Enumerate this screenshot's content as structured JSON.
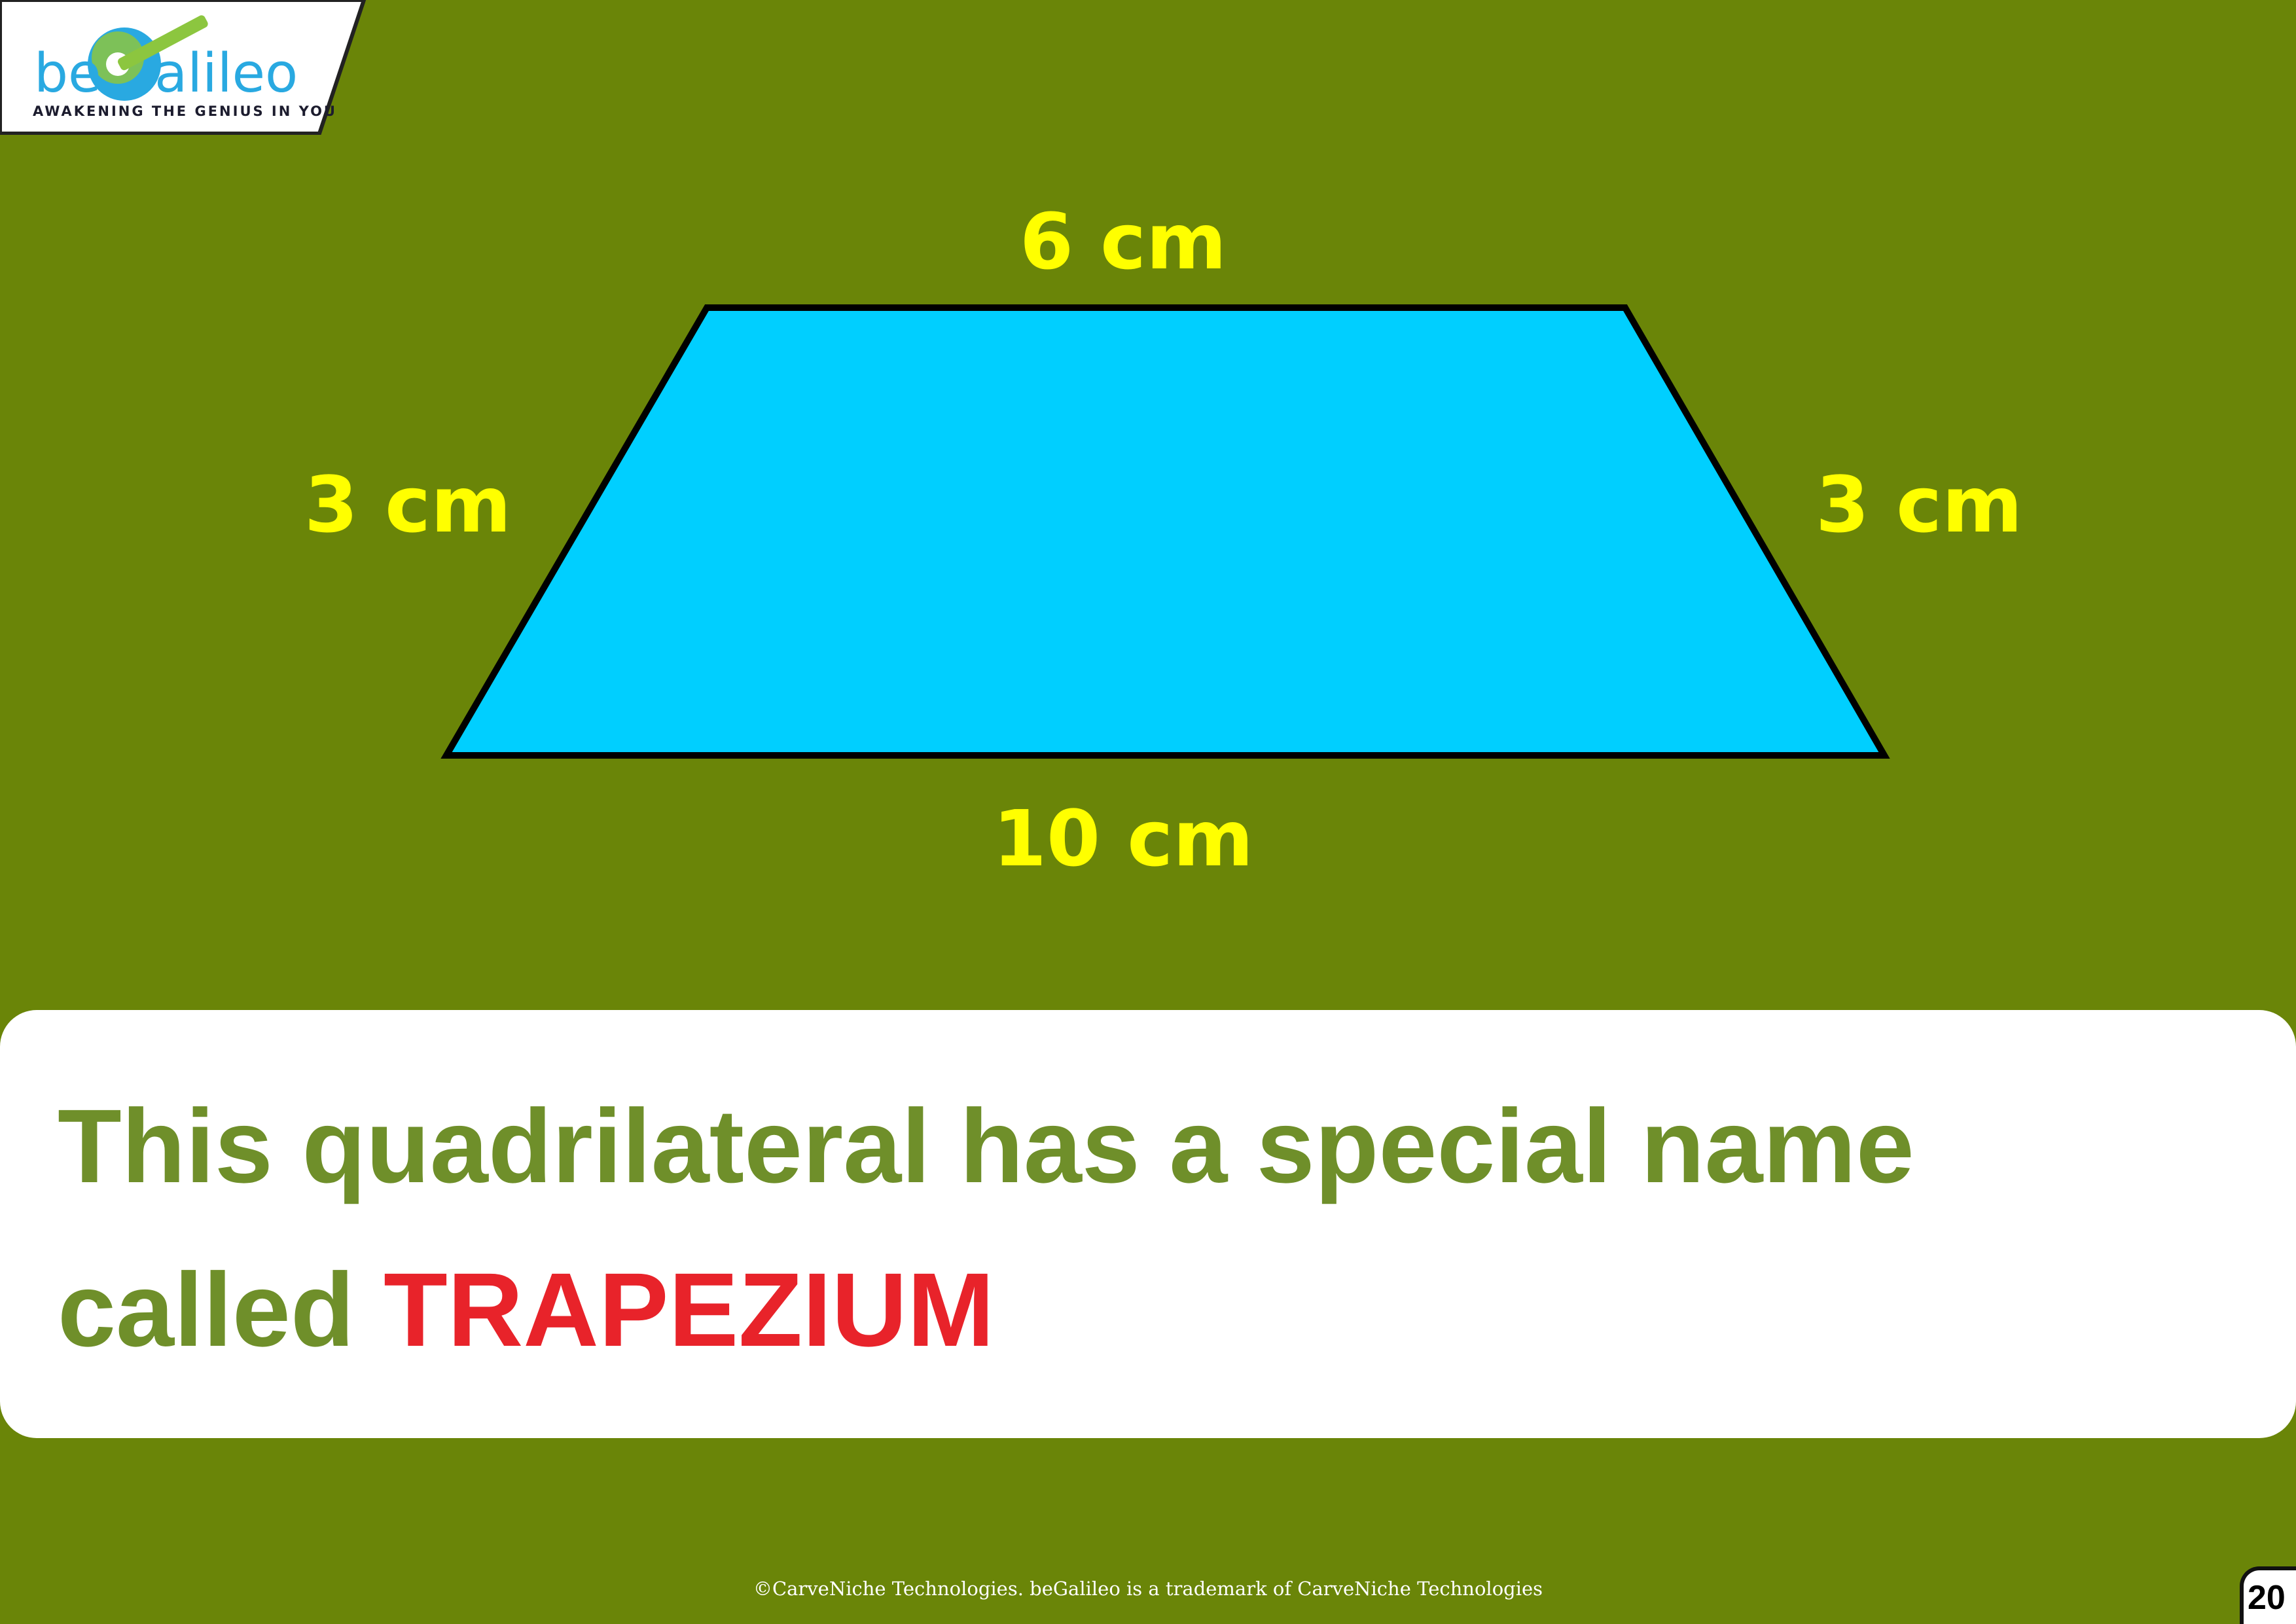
{
  "logo": {
    "text": "beGalileo",
    "tagline": "AWAKENING THE GENIUS IN YOU"
  },
  "figure": {
    "shape": "trapezium",
    "fill_color": "#00cfff",
    "labels": {
      "top": "6 cm",
      "left": "3 cm",
      "right": "3 cm",
      "bottom": "10 cm"
    }
  },
  "caption": {
    "line1": "This quadrilateral has a special name",
    "line2_prefix": "called ",
    "highlight": "TRAPEZIUM"
  },
  "footer": "©CarveNiche Technologies. beGalileo is a trademark of CarveNiche Technologies",
  "page_number": "20",
  "colors": {
    "background": "#6a8508",
    "label": "#ffff00",
    "caption_text": "#6f8f2a",
    "highlight": "#e8232a"
  }
}
